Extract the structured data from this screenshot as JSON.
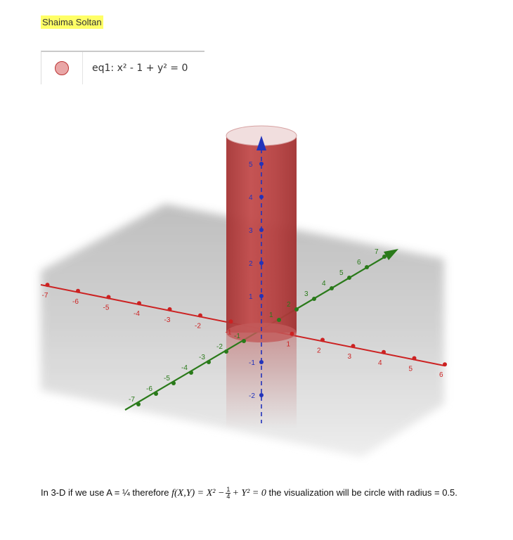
{
  "author": "Shaima Soltan",
  "algebra": {
    "equation": "eq1: x² - 1 + y² = 0"
  },
  "graph": {
    "x_ticks": [
      "-7",
      "-6",
      "-5",
      "-4",
      "-3",
      "-2",
      "-1",
      "1",
      "2",
      "3",
      "4",
      "5",
      "6"
    ],
    "y_ticks": [
      "-7",
      "-6",
      "-5",
      "-4",
      "-3",
      "-2",
      "-1",
      "1",
      "2",
      "3",
      "4",
      "5",
      "6",
      "7"
    ],
    "z_ticks": [
      "5",
      "4",
      "3",
      "2",
      "1",
      "-1",
      "-2"
    ],
    "colors": {
      "x_axis": "#cc2222",
      "y_axis": "#2a7a1a",
      "z_axis": "#2233bb",
      "cylinder": "#b53a3a"
    }
  },
  "caption": {
    "prefix": "In 3-D if we use A = ¼ therefore",
    "fxy": "f(X,Y) =",
    "expr1": "X² −",
    "frac_num": "1",
    "frac_den": "4",
    "expr2": "+ Y² = 0",
    "suffix": "the visualization will be circle with radius = 0.5."
  }
}
